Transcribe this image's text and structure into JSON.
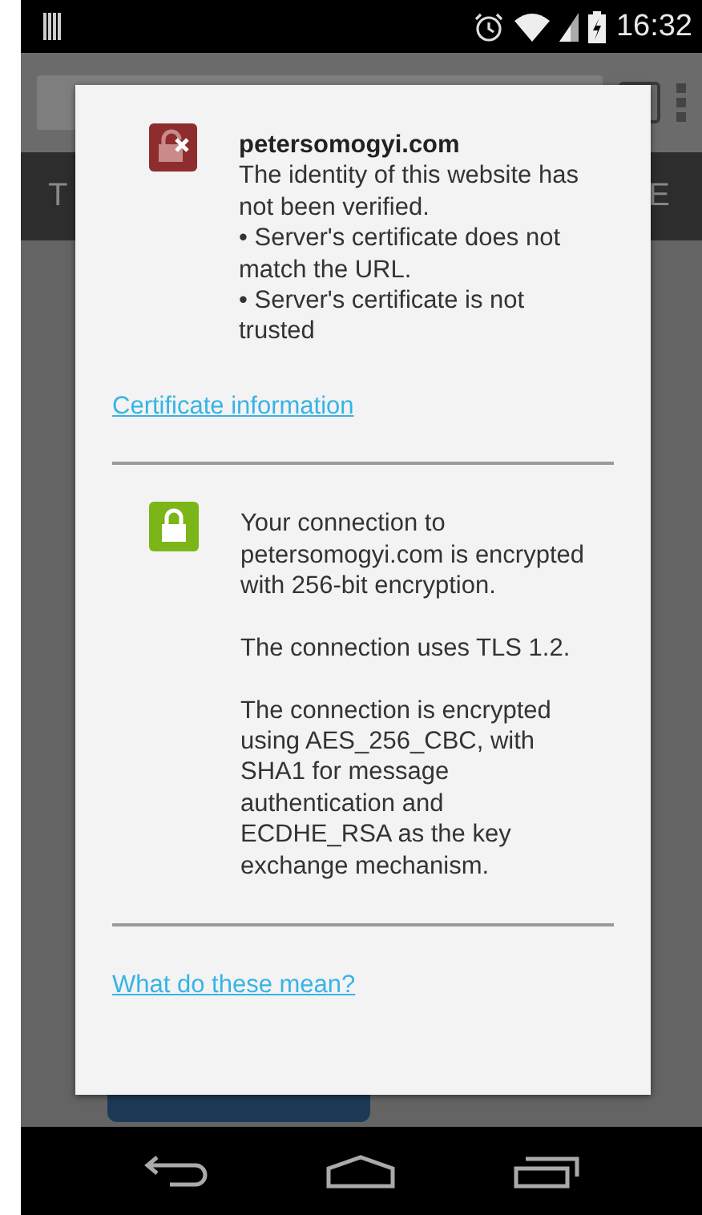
{
  "status_bar": {
    "time": "16:32"
  },
  "background": {
    "tab_left": "T",
    "tab_right": "E"
  },
  "dialog": {
    "sections": [
      {
        "kind": "error",
        "title": "petersomogyi.com",
        "lines": [
          "The identity of this website has not been verified.",
          "• Server's certificate does not match the URL.",
          "• Server's certificate is not trusted"
        ],
        "link": "Certificate information"
      },
      {
        "kind": "secure",
        "paragraphs": [
          "Your connection to petersomogyi.com is encrypted with 256-bit encryption.",
          "The connection uses TLS 1.2.",
          "The connection is encrypted using AES_256_CBC, with SHA1 for message authentication and ECDHE_RSA as the key exchange mechanism."
        ]
      }
    ],
    "footer_link": "What do these mean?"
  }
}
